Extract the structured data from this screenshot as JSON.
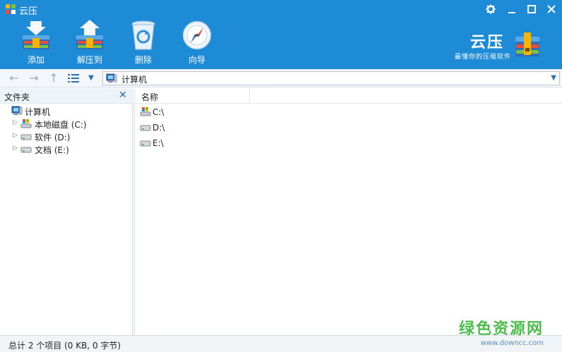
{
  "window": {
    "title": "云压"
  },
  "toolbar": {
    "add_label": "添加",
    "extract_label": "解压到",
    "delete_label": "删除",
    "wizard_label": "向导"
  },
  "brand": {
    "name": "云压",
    "slogan": "最懂你的压缩软件"
  },
  "address": {
    "value": "计算机"
  },
  "sidebar": {
    "title": "文件夹",
    "root": "计算机",
    "items": [
      {
        "label": "本地磁盘 (C:)",
        "icon": "system-drive-icon"
      },
      {
        "label": "软件 (D:)",
        "icon": "drive-icon"
      },
      {
        "label": "文档 (E:)",
        "icon": "drive-icon"
      }
    ]
  },
  "main": {
    "columns": [
      "名称"
    ],
    "rows": [
      {
        "name": "C:\\",
        "icon": "system-drive-icon"
      },
      {
        "name": "D:\\",
        "icon": "drive-icon"
      },
      {
        "name": "E:\\",
        "icon": "drive-icon"
      }
    ]
  },
  "status": {
    "text": "总计 2 个项目 (0 KB, 0 字节)"
  },
  "watermark": {
    "main": "绿色资源网",
    "sub": "www.downcc.com"
  },
  "colors": {
    "header": "#1e8bd6",
    "accent": "#1e6fc0",
    "watermark": "#4bbf4b"
  }
}
